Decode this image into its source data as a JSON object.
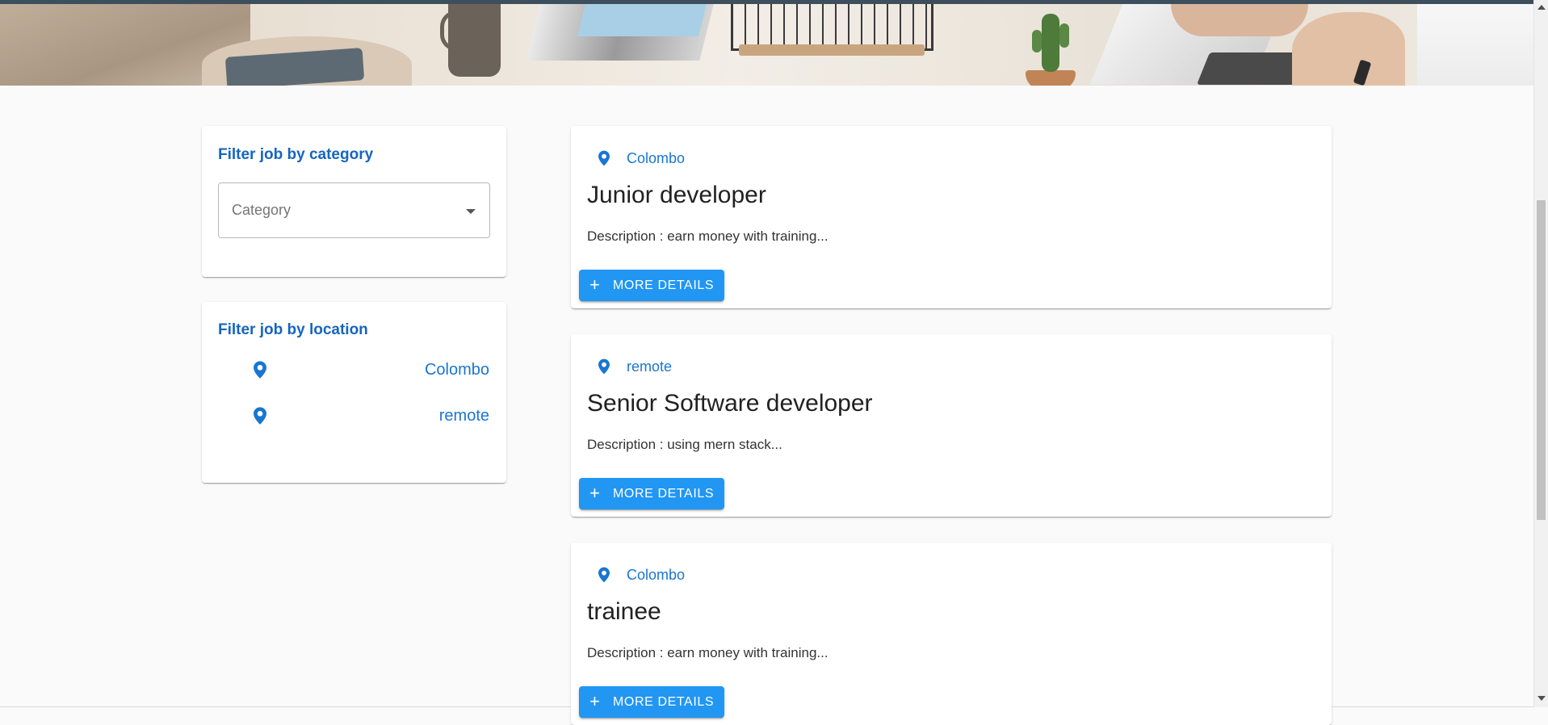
{
  "filters": {
    "category": {
      "title": "Filter job by category",
      "placeholder": "Category"
    },
    "location": {
      "title": "Filter job by location",
      "items": [
        {
          "label": "Colombo",
          "icon": "location-pin-icon"
        },
        {
          "label": "remote",
          "icon": "location-pin-icon"
        }
      ]
    }
  },
  "jobs": [
    {
      "location": "Colombo",
      "title": "Junior developer",
      "description": "Description : earn money with training...",
      "button": "MORE DETAILS"
    },
    {
      "location": "remote",
      "title": "Senior Software developer",
      "description": "Description : using mern stack...",
      "button": "MORE DETAILS"
    },
    {
      "location": "Colombo",
      "title": "trainee",
      "description": "Description : earn money with training...",
      "button": "MORE DETAILS"
    }
  ],
  "colors": {
    "primary": "#1976d2",
    "button": "#2196f3",
    "background": "#fafafa",
    "topbar": "#3d4f5c"
  }
}
